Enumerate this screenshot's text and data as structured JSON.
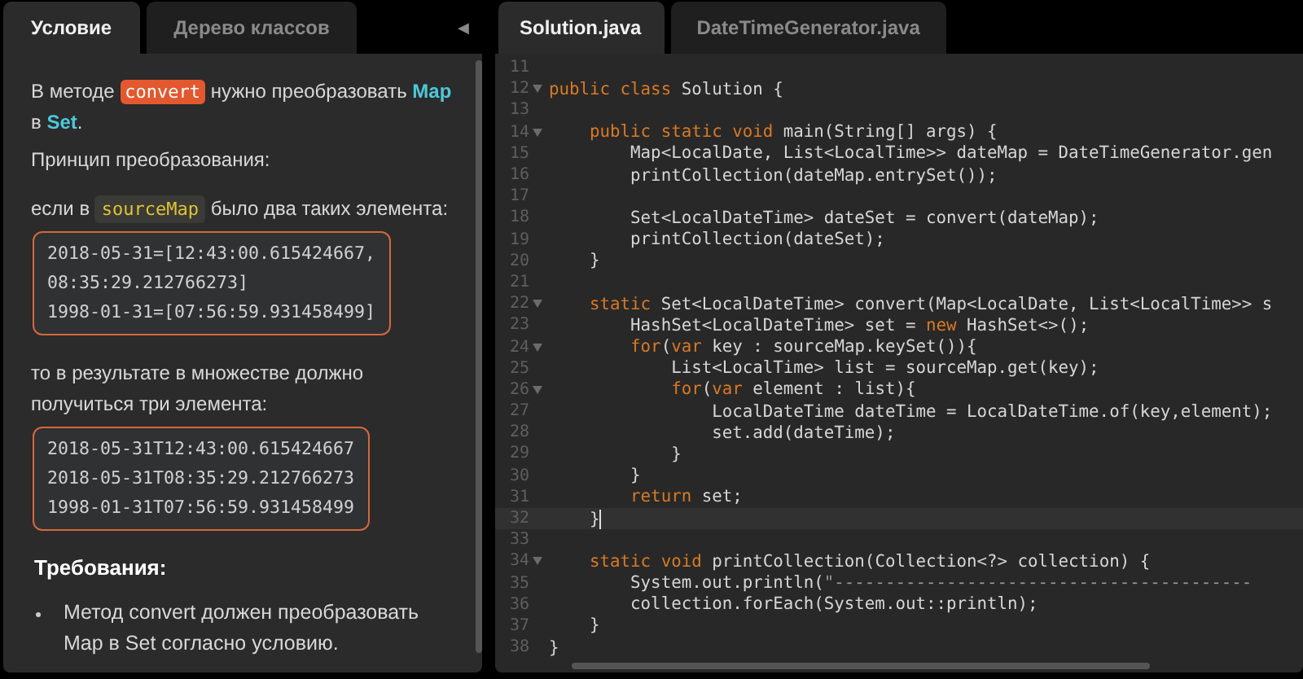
{
  "task_panel": {
    "tabs": [
      {
        "label": "Условие",
        "selected": true
      },
      {
        "label": "Дерево классов",
        "selected": false
      }
    ],
    "collapse_button": "◀",
    "blocks": [
      {
        "kind": "paragraph",
        "segments": [
          {
            "kind": "plain",
            "text": "В методе "
          },
          {
            "kind": "method",
            "text": "convert"
          },
          {
            "kind": "plain",
            "text": " нужно преобразовать "
          },
          {
            "kind": "type",
            "text": "Map"
          },
          {
            "kind": "plain",
            "text": " в "
          },
          {
            "kind": "type",
            "text": "Set"
          },
          {
            "kind": "plain",
            "text": "."
          }
        ]
      },
      {
        "kind": "line",
        "segments": [
          {
            "kind": "plain",
            "text": "Принцип преобразования:"
          }
        ]
      },
      {
        "kind": "paragraph",
        "segments": [
          {
            "kind": "plain",
            "text": "если в "
          },
          {
            "kind": "variable",
            "text": "sourceMap"
          },
          {
            "kind": "plain",
            "text": " было два таких элемента:"
          }
        ]
      },
      {
        "kind": "code",
        "lines": [
          "2018-05-31=[12:43:00.615424667,",
          "08:35:29.212766273]",
          "1998-01-31=[07:56:59.931458499]"
        ]
      },
      {
        "kind": "paragraph",
        "segments": [
          {
            "kind": "plain",
            "text": "то в результате в множестве должно получиться три элемента:"
          }
        ]
      },
      {
        "kind": "code",
        "lines": [
          "2018-05-31T12:43:00.615424667",
          "2018-05-31T08:35:29.212766273",
          "1998-01-31T07:56:59.931458499"
        ]
      },
      {
        "kind": "heading",
        "segments": [
          {
            "kind": "plain",
            "text": "Требования:"
          }
        ]
      },
      {
        "kind": "bullet",
        "segments": [
          {
            "kind": "plain",
            "text": "Метод convert должен преобразовать Map в Set согласно условию."
          }
        ]
      }
    ]
  },
  "editor": {
    "tabs": [
      {
        "label": "Solution.java",
        "selected": true
      },
      {
        "label": "DateTimeGenerator.java",
        "selected": false
      }
    ],
    "lines": [
      {
        "number": "11",
        "foldable": false,
        "current": false
      },
      {
        "number": "12",
        "foldable": true,
        "current": false,
        "tokens": [
          {
            "kind": "kw",
            "text": "public class"
          },
          {
            "kind": "plain",
            "text": " Solution {"
          }
        ]
      },
      {
        "number": "13",
        "foldable": false,
        "current": false
      },
      {
        "number": "14",
        "foldable": true,
        "current": false,
        "tokens": [
          {
            "kind": "kw",
            "text": "    public static void"
          },
          {
            "kind": "plain",
            "text": " main(String[] args) {"
          }
        ]
      },
      {
        "number": "15",
        "foldable": false,
        "current": false,
        "tokens": [
          {
            "kind": "plain",
            "text": "        Map<LocalDate, List<LocalTime>> dateMap = DateTimeGenerator.gen"
          }
        ]
      },
      {
        "number": "16",
        "foldable": false,
        "current": false,
        "tokens": [
          {
            "kind": "plain",
            "text": "        printCollection(dateMap.entrySet());"
          }
        ]
      },
      {
        "number": "17",
        "foldable": false,
        "current": false
      },
      {
        "number": "18",
        "foldable": false,
        "current": false,
        "tokens": [
          {
            "kind": "plain",
            "text": "        Set<LocalDateTime> dateSet = convert(dateMap);"
          }
        ]
      },
      {
        "number": "19",
        "foldable": false,
        "current": false,
        "tokens": [
          {
            "kind": "plain",
            "text": "        printCollection(dateSet);"
          }
        ]
      },
      {
        "number": "20",
        "foldable": false,
        "current": false,
        "tokens": [
          {
            "kind": "plain",
            "text": "    }"
          }
        ]
      },
      {
        "number": "21",
        "foldable": false,
        "current": false
      },
      {
        "number": "22",
        "foldable": true,
        "current": false,
        "tokens": [
          {
            "kind": "kw",
            "text": "    static"
          },
          {
            "kind": "plain",
            "text": " Set<LocalDateTime> convert(Map<LocalDate, List<LocalTime>> s"
          }
        ]
      },
      {
        "number": "23",
        "foldable": false,
        "current": false,
        "tokens": [
          {
            "kind": "plain",
            "text": "        HashSet<LocalDateTime> set = "
          },
          {
            "kind": "kw",
            "text": "new"
          },
          {
            "kind": "plain",
            "text": " HashSet<>();"
          }
        ]
      },
      {
        "number": "24",
        "foldable": true,
        "current": false,
        "tokens": [
          {
            "kind": "kw",
            "text": "        for"
          },
          {
            "kind": "plain",
            "text": "("
          },
          {
            "kind": "kw",
            "text": "var"
          },
          {
            "kind": "plain",
            "text": " key : sourceMap.keySet()){"
          }
        ]
      },
      {
        "number": "25",
        "foldable": false,
        "current": false,
        "tokens": [
          {
            "kind": "plain",
            "text": "            List<LocalTime> list = sourceMap.get(key);"
          }
        ]
      },
      {
        "number": "26",
        "foldable": true,
        "current": false,
        "tokens": [
          {
            "kind": "kw",
            "text": "            for"
          },
          {
            "kind": "plain",
            "text": "("
          },
          {
            "kind": "kw",
            "text": "var"
          },
          {
            "kind": "plain",
            "text": " element : list){"
          }
        ]
      },
      {
        "number": "27",
        "foldable": false,
        "current": false,
        "tokens": [
          {
            "kind": "plain",
            "text": "                LocalDateTime dateTime = LocalDateTime.of(key,element);"
          }
        ]
      },
      {
        "number": "28",
        "foldable": false,
        "current": false,
        "tokens": [
          {
            "kind": "plain",
            "text": "                set.add(dateTime);"
          }
        ]
      },
      {
        "number": "29",
        "foldable": false,
        "current": false,
        "tokens": [
          {
            "kind": "plain",
            "text": "            }"
          }
        ]
      },
      {
        "number": "30",
        "foldable": false,
        "current": false,
        "tokens": [
          {
            "kind": "plain",
            "text": "        }"
          }
        ]
      },
      {
        "number": "31",
        "foldable": false,
        "current": false,
        "tokens": [
          {
            "kind": "kw",
            "text": "        return"
          },
          {
            "kind": "plain",
            "text": " set;"
          }
        ]
      },
      {
        "number": "32",
        "foldable": false,
        "current": true,
        "tokens": [
          {
            "kind": "plain",
            "text": "    }"
          }
        ]
      },
      {
        "number": "33",
        "foldable": false,
        "current": false
      },
      {
        "number": "34",
        "foldable": true,
        "current": false,
        "tokens": [
          {
            "kind": "kw",
            "text": "    static void"
          },
          {
            "kind": "plain",
            "text": " printCollection(Collection<?> collection) {"
          }
        ]
      },
      {
        "number": "35",
        "foldable": false,
        "current": false,
        "tokens": [
          {
            "kind": "plain",
            "text": "        System.out.println("
          },
          {
            "kind": "string",
            "text": "\"-----------------------------------------"
          }
        ]
      },
      {
        "number": "36",
        "foldable": false,
        "current": false,
        "tokens": [
          {
            "kind": "plain",
            "text": "        collection.forEach(System.out::println);"
          }
        ]
      },
      {
        "number": "37",
        "foldable": false,
        "current": false,
        "tokens": [
          {
            "kind": "plain",
            "text": "    }"
          }
        ]
      },
      {
        "number": "38",
        "foldable": false,
        "current": false,
        "tokens": [
          {
            "kind": "plain",
            "text": "}"
          }
        ]
      }
    ]
  }
}
